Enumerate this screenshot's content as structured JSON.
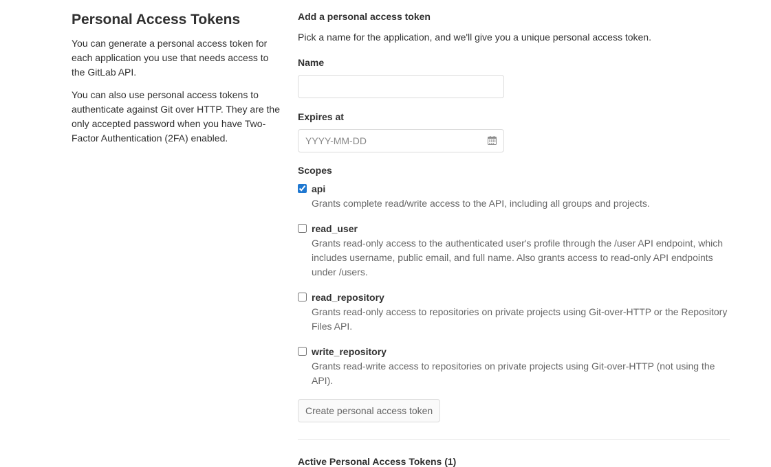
{
  "left": {
    "title": "Personal Access Tokens",
    "paragraph_1": "You can generate a personal access token for each application you use that needs access to the GitLab API.",
    "paragraph_2": "You can also use personal access tokens to authenticate against Git over HTTP. They are the only accepted password when you have Two-Factor Authentication (2FA) enabled."
  },
  "form": {
    "heading": "Add a personal access token",
    "intro": "Pick a name for the application, and we'll give you a unique personal access token.",
    "name_label": "Name",
    "name_value": "",
    "expires_label": "Expires at",
    "expires_placeholder": "YYYY-MM-DD",
    "expires_icon": "calendar-icon",
    "scopes_label": "Scopes",
    "scopes": [
      {
        "name": "api",
        "checked": true,
        "description": "Grants complete read/write access to the API, including all groups and projects."
      },
      {
        "name": "read_user",
        "checked": false,
        "description": "Grants read-only access to the authenticated user's profile through the /user API endpoint, which includes username, public email, and full name. Also grants access to read-only API endpoints under /users."
      },
      {
        "name": "read_repository",
        "checked": false,
        "description": "Grants read-only access to repositories on private projects using Git-over-HTTP or the Repository Files API."
      },
      {
        "name": "write_repository",
        "checked": false,
        "description": "Grants read-write access to repositories on private projects using Git-over-HTTP (not using the API)."
      }
    ],
    "submit_label": "Create personal access token"
  },
  "active_tokens": {
    "heading": "Active Personal Access Tokens (1)"
  },
  "colors": {
    "text": "#303030",
    "muted": "#666666",
    "border": "#dbdbdb",
    "checkbox_accent": "#1f78d1"
  }
}
